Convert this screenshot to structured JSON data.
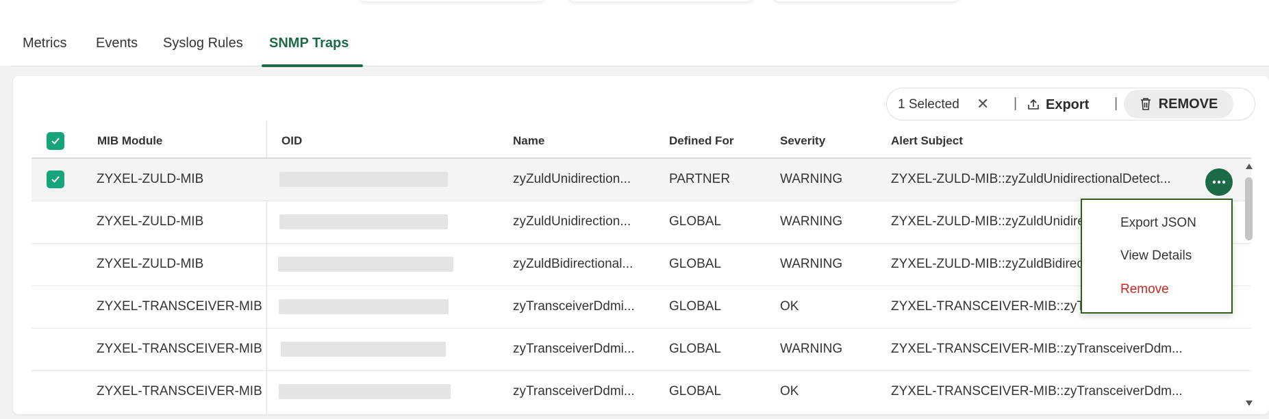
{
  "tabs": [
    {
      "label": "Metrics"
    },
    {
      "label": "Events"
    },
    {
      "label": "Syslog Rules"
    },
    {
      "label": "SNMP Traps"
    }
  ],
  "selection": {
    "count_label": "1 Selected",
    "export_label": "Export",
    "remove_label": "REMOVE",
    "separator": "|"
  },
  "columns": {
    "mib_module": "MIB Module",
    "oid": "OID",
    "name": "Name",
    "defined_for": "Defined For",
    "severity": "Severity",
    "alert_subject": "Alert Subject"
  },
  "rows": [
    {
      "mib_module": "ZYXEL-ZULD-MIB",
      "name": "zyZuldUnidirection...",
      "defined_for": "PARTNER",
      "severity": "WARNING",
      "alert_subject": "ZYXEL-ZULD-MIB::zyZuldUnidirectionalDetect...",
      "selected": true
    },
    {
      "mib_module": "ZYXEL-ZULD-MIB",
      "name": "zyZuldUnidirection...",
      "defined_for": "GLOBAL",
      "severity": "WARNING",
      "alert_subject": "ZYXEL-ZULD-MIB::zyZuldUnidire",
      "selected": false
    },
    {
      "mib_module": "ZYXEL-ZULD-MIB",
      "name": "zyZuldBidirectional...",
      "defined_for": "GLOBAL",
      "severity": "WARNING",
      "alert_subject": "ZYXEL-ZULD-MIB::zyZuldBidirec",
      "selected": false
    },
    {
      "mib_module": "ZYXEL-TRANSCEIVER-MIB",
      "name": "zyTransceiverDdmi...",
      "defined_for": "GLOBAL",
      "severity": "OK",
      "alert_subject": "ZYXEL-TRANSCEIVER-MIB::zyTra",
      "selected": false
    },
    {
      "mib_module": "ZYXEL-TRANSCEIVER-MIB",
      "name": "zyTransceiverDdmi...",
      "defined_for": "GLOBAL",
      "severity": "WARNING",
      "alert_subject": "ZYXEL-TRANSCEIVER-MIB::zyTransceiverDdm...",
      "selected": false
    },
    {
      "mib_module": "ZYXEL-TRANSCEIVER-MIB",
      "name": "zyTransceiverDdmi...",
      "defined_for": "GLOBAL",
      "severity": "OK",
      "alert_subject": "ZYXEL-TRANSCEIVER-MIB::zyTransceiverDdm...",
      "selected": false
    }
  ],
  "context_menu": {
    "items": [
      {
        "label": "Export JSON"
      },
      {
        "label": "View Details"
      },
      {
        "label": "Remove"
      }
    ]
  },
  "colors": {
    "accent": "#1c6b48",
    "checkbox": "#17a47c",
    "danger": "#c9271f",
    "menu_border": "#2f5e18"
  }
}
